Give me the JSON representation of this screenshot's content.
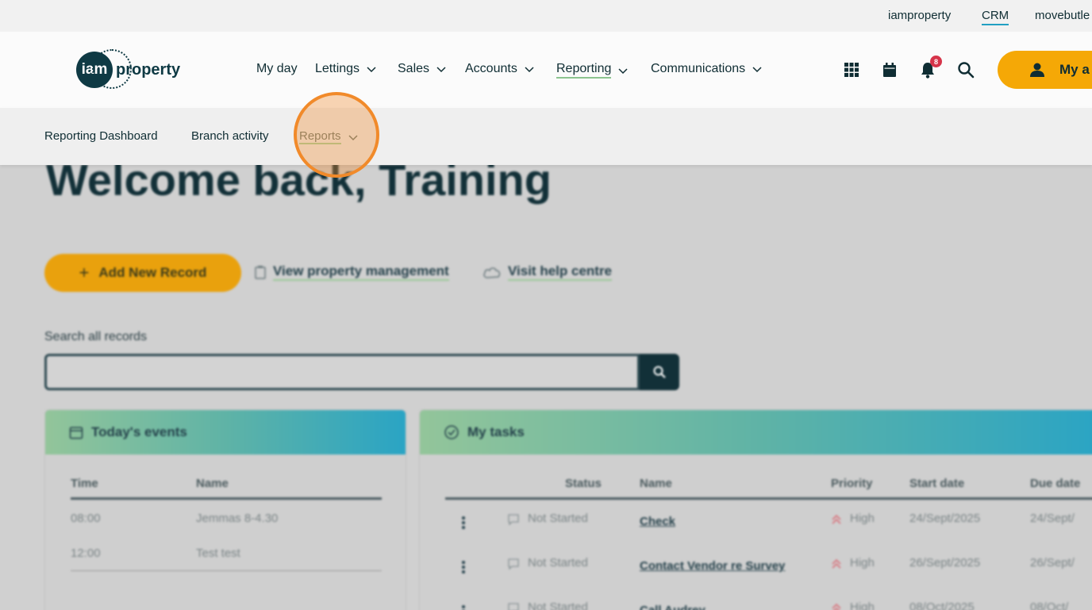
{
  "utility": {
    "items": [
      {
        "label": "iamproperty"
      },
      {
        "label": "CRM"
      },
      {
        "label": "movebutle"
      }
    ]
  },
  "logo": {
    "mark": "iam",
    "word": "property"
  },
  "nav": {
    "items": [
      {
        "label": "My day"
      },
      {
        "label": "Lettings"
      },
      {
        "label": "Sales"
      },
      {
        "label": "Accounts"
      },
      {
        "label": "Reporting"
      },
      {
        "label": "Communications"
      }
    ],
    "notification_count": "8",
    "account_label": "My a"
  },
  "subnav": {
    "items": [
      {
        "label": "Reporting Dashboard"
      },
      {
        "label": "Branch activity"
      },
      {
        "label": "Reports"
      }
    ]
  },
  "content": {
    "welcome": "Welcome back, Training",
    "add_record": "Add New Record",
    "view_property": "View property management",
    "help_centre": "Visit help centre",
    "search_label": "Search all records",
    "search_value": ""
  },
  "events": {
    "title": "Today's events",
    "columns": [
      "Time",
      "Name"
    ],
    "rows": [
      {
        "time": "08:00",
        "name": "Jemmas 8-4.30"
      },
      {
        "time": "12:00",
        "name": "Test test"
      }
    ]
  },
  "tasks": {
    "title": "My tasks",
    "columns": [
      "Status",
      "Name",
      "Priority",
      "Start date",
      "Due date"
    ],
    "rows": [
      {
        "status": "Not Started",
        "name": "Check",
        "priority": "High",
        "start": "24/Sept/2025",
        "due": "24/Sept/"
      },
      {
        "status": "Not Started",
        "name": "Contact Vendor re Survey",
        "priority": "High",
        "start": "26/Sept/2025",
        "due": "26/Sept/"
      },
      {
        "status": "Not Started",
        "name": "Call Audrey",
        "priority": "High",
        "start": "08/Oct/2025",
        "due": "08/Oct/"
      }
    ]
  },
  "colors": {
    "accent": "#f5a806",
    "brand": "#0f3a44",
    "highlight": "#f18a2a"
  }
}
